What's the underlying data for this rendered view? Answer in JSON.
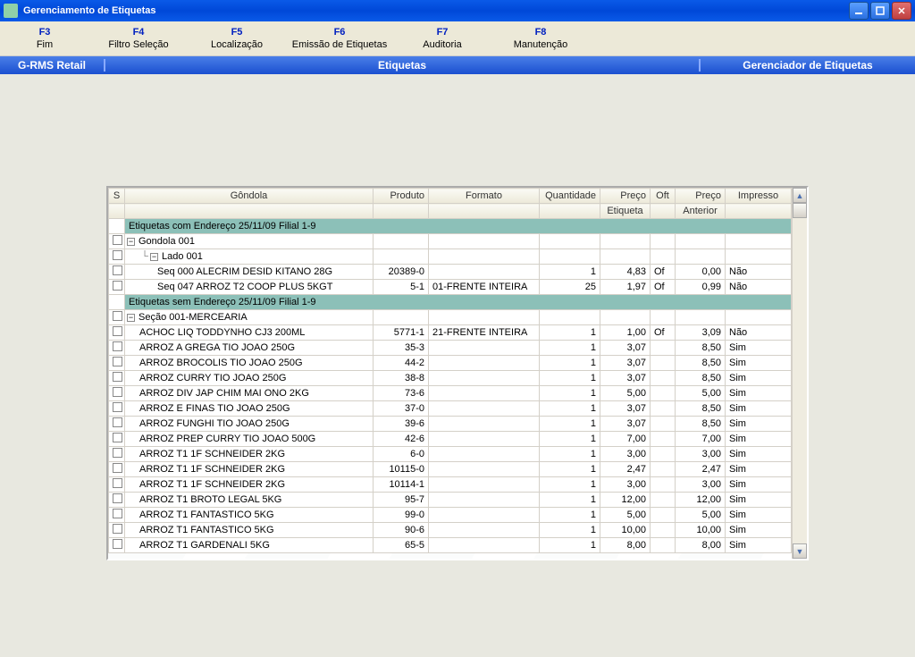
{
  "window": {
    "title": "Gerenciamento de Etiquetas"
  },
  "menu": [
    {
      "key": "F3",
      "label": "Fim"
    },
    {
      "key": "F4",
      "label": "Filtro Seleção"
    },
    {
      "key": "F5",
      "label": "Localização"
    },
    {
      "key": "F6",
      "label": "Emissão de Etiquetas"
    },
    {
      "key": "F7",
      "label": "Auditoria"
    },
    {
      "key": "F8",
      "label": "Manutenção"
    }
  ],
  "infobar": {
    "left": "G-RMS Retail",
    "center": "Etiquetas",
    "right": "Gerenciador de Etiquetas"
  },
  "columns": {
    "s": "S",
    "gondola": "Gôndola",
    "produto": "Produto",
    "formato": "Formato",
    "qtd": "Quantidade",
    "preco": "Preço",
    "oft": "Oft",
    "precoant": "Preço",
    "impresso": "Impresso",
    "sub_preco": "Etiqueta",
    "sub_precoant": "Anterior"
  },
  "sections": {
    "s1": "Etiquetas com Endereço 25/11/09 Filial 1-9",
    "s2": "Etiquetas sem Endereço 25/11/09 Filial 1-9"
  },
  "tree": {
    "gondola": "Gondola 001",
    "lado": "Lado 001",
    "secao": "Seção 001-MERCEARIA"
  },
  "rows": {
    "r1": {
      "g": "Seq 000 ALECRIM DESID KITANO 28G",
      "prod": "20389-0",
      "fmt": "",
      "q": "1",
      "pr": "4,83",
      "oft": "Of",
      "pa": "0,00",
      "imp": "Não"
    },
    "r2": {
      "g": "Seq 047 ARROZ T2 COOP PLUS 5KGT",
      "prod": "5-1",
      "fmt": "01-FRENTE INTEIRA",
      "q": "25",
      "pr": "1,97",
      "oft": "Of",
      "pa": "0,99",
      "imp": "Não"
    },
    "r3": {
      "g": "ACHOC LIQ TODDYNHO CJ3 200ML",
      "prod": "5771-1",
      "fmt": "21-FRENTE INTEIRA",
      "q": "1",
      "pr": "1,00",
      "oft": "Of",
      "pa": "3,09",
      "imp": "Não"
    },
    "r4": {
      "g": "ARROZ A GREGA TIO JOAO 250G",
      "prod": "35-3",
      "fmt": "",
      "q": "1",
      "pr": "3,07",
      "oft": "",
      "pa": "8,50",
      "imp": "Sim"
    },
    "r5": {
      "g": "ARROZ BROCOLIS TIO JOAO 250G",
      "prod": "44-2",
      "fmt": "",
      "q": "1",
      "pr": "3,07",
      "oft": "",
      "pa": "8,50",
      "imp": "Sim"
    },
    "r6": {
      "g": "ARROZ CURRY TIO JOAO 250G",
      "prod": "38-8",
      "fmt": "",
      "q": "1",
      "pr": "3,07",
      "oft": "",
      "pa": "8,50",
      "imp": "Sim"
    },
    "r7": {
      "g": "ARROZ DIV JAP CHIM MAI ONO 2KG",
      "prod": "73-6",
      "fmt": "",
      "q": "1",
      "pr": "5,00",
      "oft": "",
      "pa": "5,00",
      "imp": "Sim"
    },
    "r8": {
      "g": "ARROZ E FINAS TIO JOAO 250G",
      "prod": "37-0",
      "fmt": "",
      "q": "1",
      "pr": "3,07",
      "oft": "",
      "pa": "8,50",
      "imp": "Sim"
    },
    "r9": {
      "g": "ARROZ FUNGHI TIO JOAO 250G",
      "prod": "39-6",
      "fmt": "",
      "q": "1",
      "pr": "3,07",
      "oft": "",
      "pa": "8,50",
      "imp": "Sim"
    },
    "r10": {
      "g": "ARROZ PREP CURRY TIO JOAO 500G",
      "prod": "42-6",
      "fmt": "",
      "q": "1",
      "pr": "7,00",
      "oft": "",
      "pa": "7,00",
      "imp": "Sim"
    },
    "r11": {
      "g": "ARROZ T1 1F SCHNEIDER 2KG",
      "prod": "6-0",
      "fmt": "",
      "q": "1",
      "pr": "3,00",
      "oft": "",
      "pa": "3,00",
      "imp": "Sim"
    },
    "r12": {
      "g": "ARROZ T1 1F SCHNEIDER 2KG",
      "prod": "10115-0",
      "fmt": "",
      "q": "1",
      "pr": "2,47",
      "oft": "",
      "pa": "2,47",
      "imp": "Sim"
    },
    "r13": {
      "g": "ARROZ T1 1F SCHNEIDER 2KG",
      "prod": "10114-1",
      "fmt": "",
      "q": "1",
      "pr": "3,00",
      "oft": "",
      "pa": "3,00",
      "imp": "Sim"
    },
    "r14": {
      "g": "ARROZ T1 BROTO LEGAL 5KG",
      "prod": "95-7",
      "fmt": "",
      "q": "1",
      "pr": "12,00",
      "oft": "",
      "pa": "12,00",
      "imp": "Sim"
    },
    "r15": {
      "g": "ARROZ T1 FANTASTICO 5KG",
      "prod": "99-0",
      "fmt": "",
      "q": "1",
      "pr": "5,00",
      "oft": "",
      "pa": "5,00",
      "imp": "Sim"
    },
    "r16": {
      "g": "ARROZ T1 FANTASTICO 5KG",
      "prod": "90-6",
      "fmt": "",
      "q": "1",
      "pr": "10,00",
      "oft": "",
      "pa": "10,00",
      "imp": "Sim"
    },
    "r17": {
      "g": "ARROZ T1 GARDENALI 5KG",
      "prod": "65-5",
      "fmt": "",
      "q": "1",
      "pr": "8,00",
      "oft": "",
      "pa": "8,00",
      "imp": "Sim"
    }
  }
}
